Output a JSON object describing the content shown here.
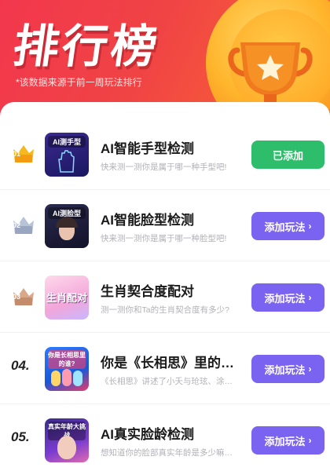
{
  "header": {
    "title": "排行榜",
    "subtitle": "*该数据来源于前一周玩法排行"
  },
  "colors": {
    "header_red": "#f04444",
    "added_green": "#2ebd6a",
    "add_purple": "#7a63f0",
    "gold": "#ffb52c"
  },
  "items": [
    {
      "rank": "01",
      "rank_style": "gold-crown",
      "thumb_label": "AI测手型",
      "thumb_big": "",
      "title": "AI智能手型检测",
      "desc": "快来测一测你是属于哪一种手型吧!",
      "button": "已添加",
      "button_state": "added"
    },
    {
      "rank": "02",
      "rank_style": "silver-crown",
      "thumb_label": "AI测脸型",
      "thumb_big": "",
      "title": "AI智能脸型检测",
      "desc": "快来测一测你是属于哪一种脸型吧!",
      "button": "添加玩法",
      "button_state": "add"
    },
    {
      "rank": "03",
      "rank_style": "bronze-crown",
      "thumb_label": "",
      "thumb_big": "生肖配对",
      "title": "生肖契合度配对",
      "desc": "测一测你和Ta的生肖契合度有多少?",
      "button": "添加玩法",
      "button_state": "add"
    },
    {
      "rank": "04.",
      "rank_style": "number",
      "thumb_label": "你是长相思里的谁?",
      "thumb_big": "",
      "title": "你是《长相思》里的…",
      "desc": "《长相思》讲述了小夭与玱玹、涂…",
      "button": "添加玩法",
      "button_state": "add"
    },
    {
      "rank": "05.",
      "rank_style": "number",
      "thumb_label": "真实年龄大挑战",
      "thumb_big": "",
      "title": "AI真实脸龄检测",
      "desc": "想知道你的脸部真实年龄是多少嘛…",
      "button": "添加玩法",
      "button_state": "add"
    }
  ],
  "icons": {
    "trophy": "trophy-icon",
    "crown": "crown-icon",
    "arrow": "chevron-right-icon"
  }
}
